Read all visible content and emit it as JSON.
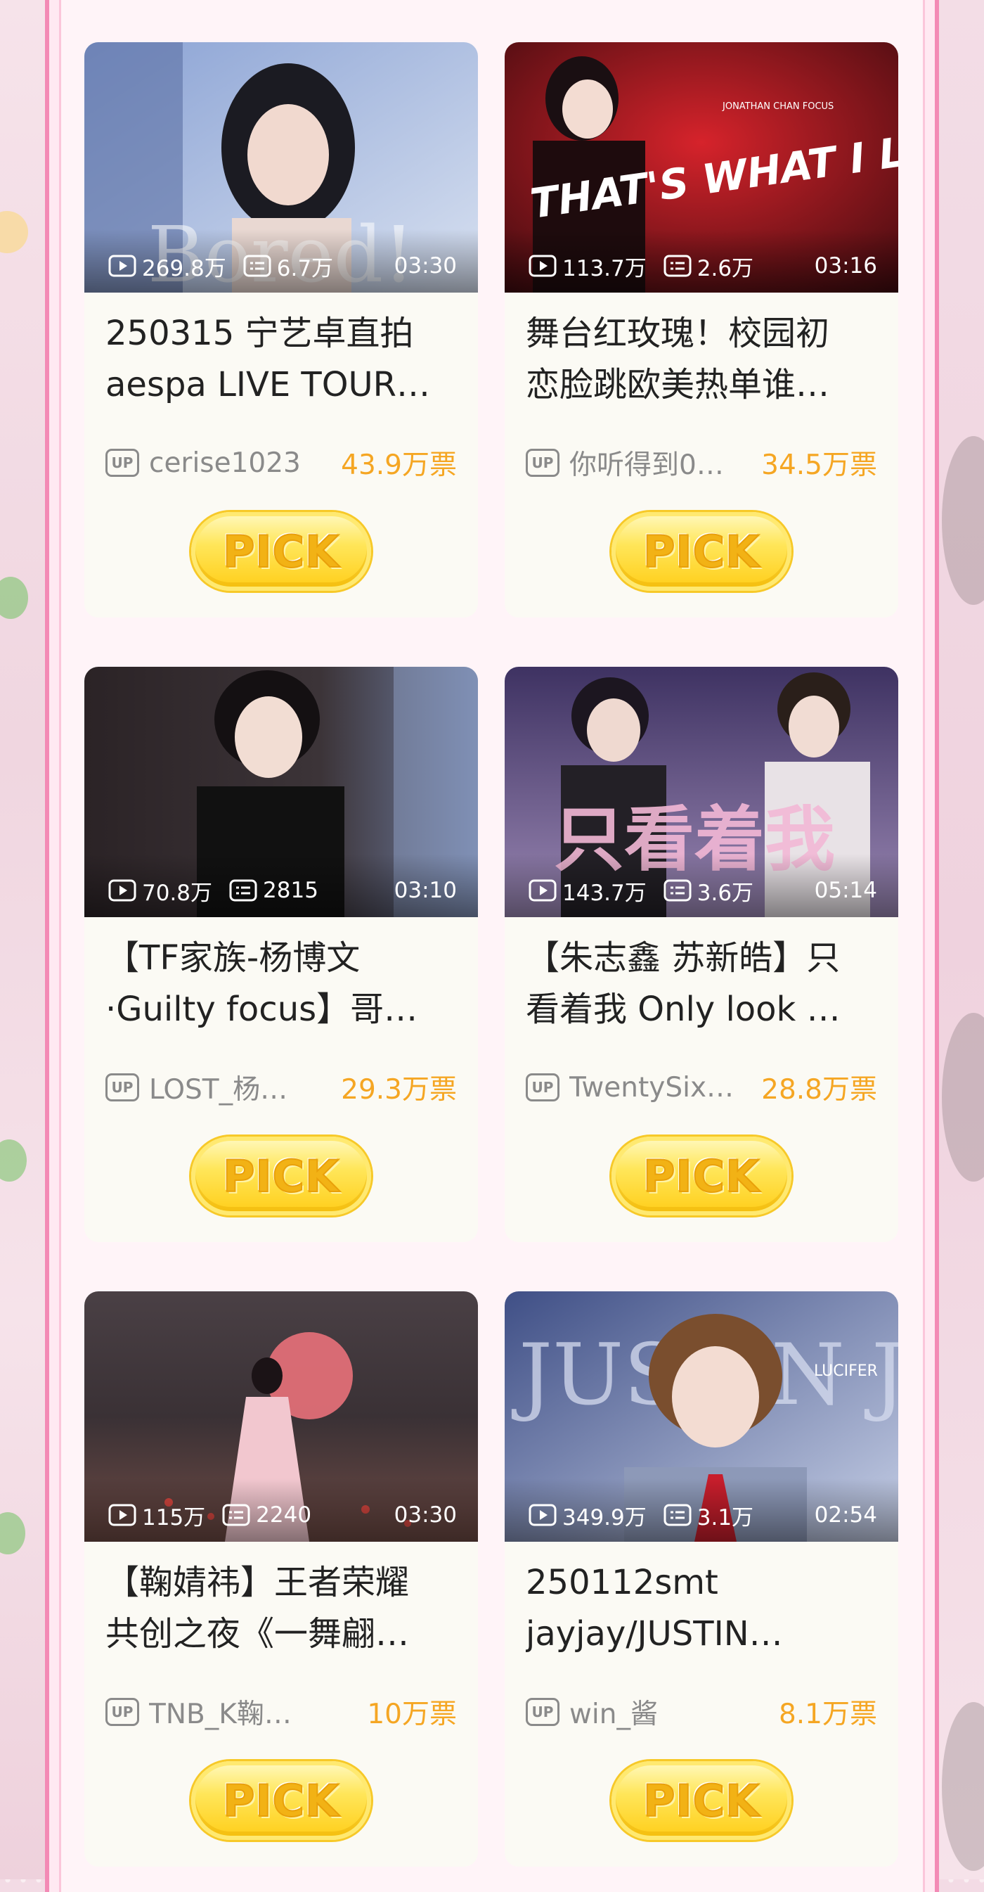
{
  "cards": [
    {
      "views": "269.8万",
      "comments": "6.7万",
      "duration": "03:30",
      "title_line1": "250315 宁艺卓直拍",
      "title_line2": "aespa LIVE TOUR…",
      "uploader": "cerise1023",
      "votes": "43.9万票",
      "pick_label": "PICK",
      "colors": {
        "a": "#6d7fb3",
        "b": "#c9d6ec"
      },
      "thumb_text": "Bored!"
    },
    {
      "views": "113.7万",
      "comments": "2.6万",
      "duration": "03:16",
      "title_line1": "舞台红玫瑰！校园初",
      "title_line2": "恋脸跳欧美热单谁…",
      "uploader": "你听得到0…",
      "votes": "34.5万票",
      "pick_label": "PICK",
      "colors": {
        "a": "#c8141b",
        "b": "#2a0508"
      },
      "thumb_text": "THAT'S WHAT I LIKE",
      "thumb_subtext": "JONATHAN CHAN FOCUS"
    },
    {
      "views": "70.8万",
      "comments": "2815",
      "duration": "03:10",
      "title_line1": "【TF家族-杨博文",
      "title_line2": "·Guilty focus】哥…",
      "uploader": "LOST_杨…",
      "votes": "29.3万票",
      "pick_label": "PICK",
      "colors": {
        "a": "#2a2326",
        "b": "#6d6d7c"
      }
    },
    {
      "views": "143.7万",
      "comments": "3.6万",
      "duration": "05:14",
      "title_line1": "【朱志鑫 苏新皓】只",
      "title_line2": "看着我 Only look …",
      "uploader": "TwentySix…",
      "votes": "28.8万票",
      "pick_label": "PICK",
      "colors": {
        "a": "#4a3a6e",
        "b": "#8c7aa8"
      },
      "thumb_text": "只看着我"
    },
    {
      "views": "115万",
      "comments": "2240",
      "duration": "03:30",
      "title_line1": "【鞠婧祎】王者荣耀",
      "title_line2": "共创之夜《一舞翩…",
      "uploader": "TNB_K鞠…",
      "votes": "10万票",
      "pick_label": "PICK",
      "colors": {
        "a": "#3a3135",
        "b": "#8a5a55"
      }
    },
    {
      "views": "349.9万",
      "comments": "3.1万",
      "duration": "02:54",
      "title_line1": "250112smt",
      "title_line2": "jayjay/JUSTIN…",
      "uploader": "win_酱",
      "votes": "8.1万票",
      "pick_label": "PICK",
      "colors": {
        "a": "#5d6ea8",
        "b": "#c7cfe4"
      },
      "thumb_text": "JUSTIN JAY",
      "thumb_subtext": "LUCIFER"
    }
  ],
  "badge_text": "UP",
  "accent": "#f5a623",
  "frame_color": "#f38ab5"
}
